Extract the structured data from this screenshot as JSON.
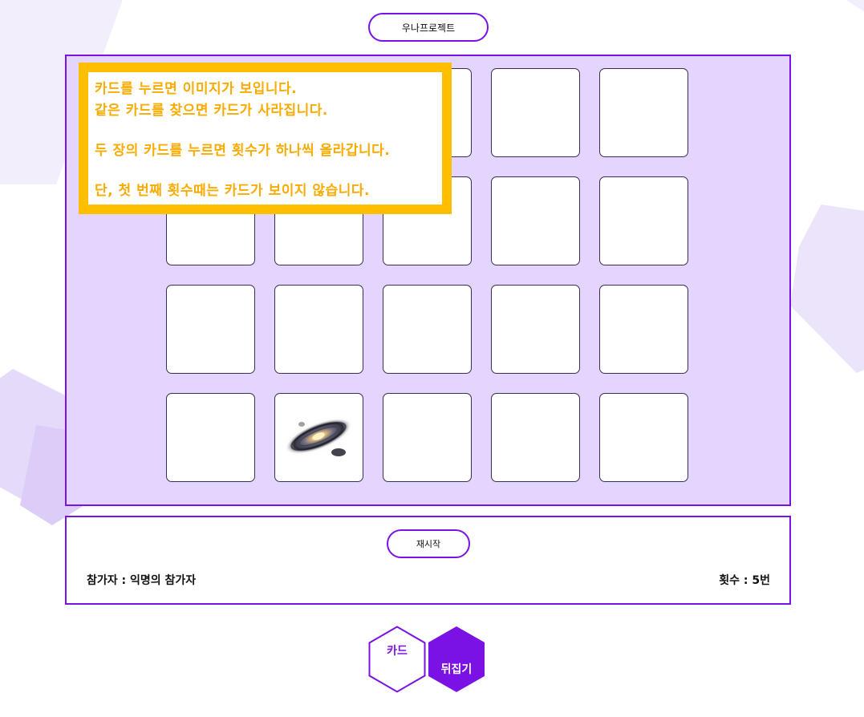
{
  "header": {
    "title": "우나프로젝트"
  },
  "notice": {
    "lines": [
      "카드를 누르면 이미지가 보입니다.",
      "같은 카드를 찾으면 카드가 사라집니다.",
      "두 장의 카드를 누르면 횟수가 하나씩 올라갑니다.",
      "단, 첫 번째 횟수때는 카드가 보이지 않습니다."
    ]
  },
  "board": {
    "rows": 4,
    "columns": 5,
    "revealed_card": {
      "row": 4,
      "column": 2,
      "image": "galaxy-image"
    }
  },
  "info": {
    "restart_label": "재시작",
    "participant_text": "참가자 : 익명의 참가자",
    "count_text": "횟수 : 5번"
  },
  "mode_buttons": {
    "card_label": "카드",
    "flip_label": "뒤집기"
  },
  "colors": {
    "accent": "#7a12e6",
    "board_bg": "#e4d5ff",
    "notice_border": "#ffbf00",
    "notice_text": "#f9ab00"
  }
}
